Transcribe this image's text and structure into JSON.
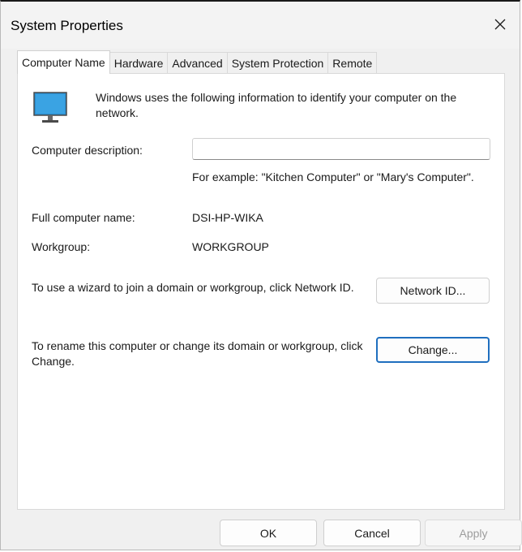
{
  "window": {
    "title": "System Properties",
    "close_icon": "close-icon"
  },
  "tabs": [
    {
      "label": "Computer Name",
      "active": true
    },
    {
      "label": "Hardware",
      "active": false
    },
    {
      "label": "Advanced",
      "active": false
    },
    {
      "label": "System Protection",
      "active": false
    },
    {
      "label": "Remote",
      "active": false
    }
  ],
  "panel": {
    "icon": "monitor-icon",
    "intro": "Windows uses the following information to identify your computer on the network.",
    "description_label": "Computer description:",
    "description_value": "",
    "description_example": "For example: \"Kitchen Computer\" or \"Mary's Computer\".",
    "full_name_label": "Full computer name:",
    "full_name_value": "DSI-HP-WIKA",
    "workgroup_label": "Workgroup:",
    "workgroup_value": "WORKGROUP",
    "network_id_text": "To use a wizard to join a domain or workgroup, click Network ID.",
    "network_id_button": "Network ID...",
    "change_text": "To rename this computer or change its domain or workgroup, click Change.",
    "change_button": "Change..."
  },
  "footer": {
    "ok": "OK",
    "cancel": "Cancel",
    "apply": "Apply",
    "apply_enabled": false
  },
  "colors": {
    "window_bg": "#f0f0f0",
    "panel_bg": "#ffffff",
    "focus_border": "#1f6fbf",
    "disabled_text": "#9d9d9d"
  }
}
